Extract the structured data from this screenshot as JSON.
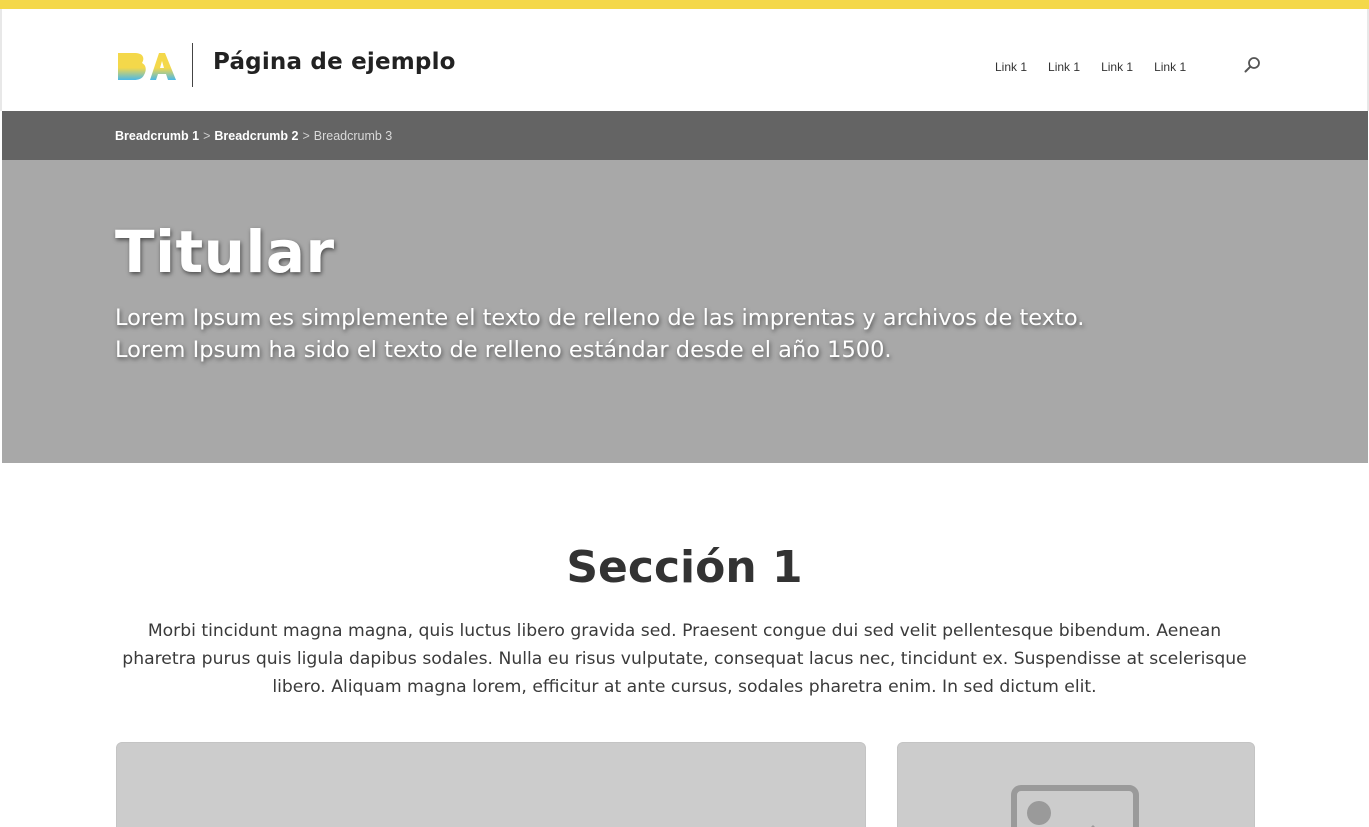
{
  "site": {
    "title": "Página de ejemplo",
    "brand_colors": [
      "#f4d84a",
      "#4ab8e8"
    ]
  },
  "nav": {
    "links": [
      "Link 1",
      "Link 1",
      "Link 1",
      "Link 1"
    ]
  },
  "breadcrumb": {
    "items": [
      "Breadcrumb 1",
      "Breadcrumb 2",
      "Breadcrumb 3"
    ],
    "separator": ">"
  },
  "hero": {
    "title": "Titular",
    "lead": "Lorem Ipsum es simplemente el texto de relleno de las imprentas y archivos de texto. Lorem Ipsum ha sido el texto de relleno estándar desde el año 1500."
  },
  "section": {
    "title": "Sección 1",
    "text": "Morbi tincidunt magna magna, quis luctus libero gravida sed. Praesent congue dui sed velit pellentesque bibendum. Aenean pharetra purus quis ligula dapibus sodales. Nulla eu risus vulputate, consequat lacus nec, tincidunt ex. Suspendisse at scelerisque libero. Aliquam magna lorem, efficitur at ante cursus, sodales pharetra enim. In sed dictum elit."
  },
  "icons": {
    "search": "search-icon",
    "image_placeholder": "image-placeholder-icon"
  },
  "colors": {
    "top_accent": "#f4d84a",
    "breadcrumb_bg": "#646464",
    "hero_bg": "#a8a8a8",
    "card_bg": "#cccccc"
  }
}
